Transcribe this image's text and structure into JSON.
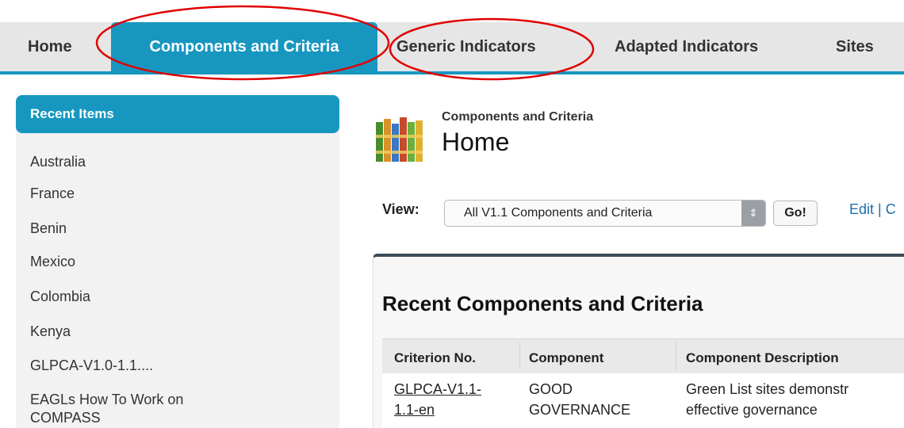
{
  "tabs": [
    {
      "label": "Home"
    },
    {
      "label": "Components and Criteria"
    },
    {
      "label": "Generic Indicators"
    },
    {
      "label": "Adapted Indicators"
    },
    {
      "label": "Sites"
    }
  ],
  "colors": {
    "accent": "#1797c0",
    "annotation": "#e00000"
  },
  "sidebar": {
    "header": "Recent Items",
    "items": [
      "Australia",
      "France",
      "Benin",
      "Mexico",
      "Colombia",
      "Kenya",
      "GLPCA-V1.0-1.1....",
      "EAGLs How To Work on",
      "COMPASS"
    ]
  },
  "page": {
    "icon": "books-icon",
    "subtitle": "Components and Criteria",
    "title": "Home"
  },
  "view": {
    "label": "View:",
    "selected": "All V1.1 Components and Criteria",
    "go_label": "Go!",
    "edit_link": "Edit | C"
  },
  "recent": {
    "title": "Recent Components and Criteria",
    "columns": [
      "Criterion No.",
      "Component",
      "Component Description"
    ],
    "rows": [
      {
        "criterion_line1": "GLPCA-V1.1-",
        "criterion_line2": "1.1-en",
        "component_line1": "GOOD",
        "component_line2": "GOVERNANCE",
        "description_line1": "Green List sites demonstr",
        "description_line2": "effective governance"
      }
    ]
  }
}
